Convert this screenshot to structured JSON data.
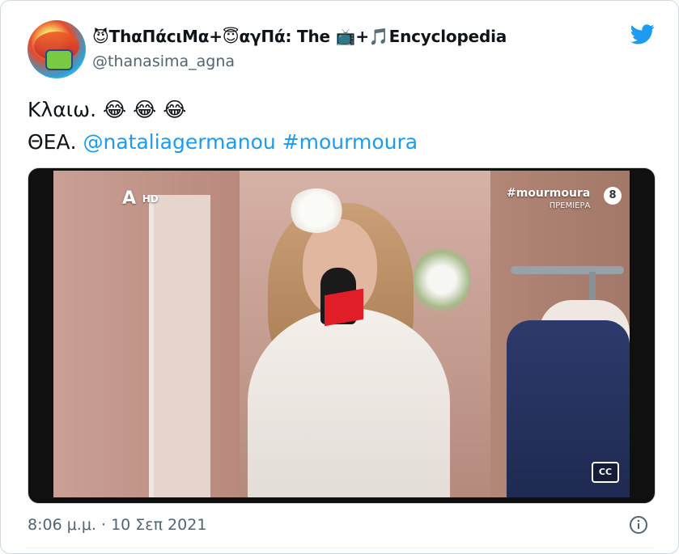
{
  "tweet": {
    "display_name": "😈ThαΠάcιΜα+😇αγΠά: The 📺+🎵Encyclopedia",
    "username": "@thanasima_agna",
    "text_line1": "Κλαιω. 😂 😂 😂",
    "text_line2_prefix": "ΘΕΑ. ",
    "mention": "@nataliagermanou",
    "hashtag": "#mourmoura",
    "timestamp": "8:06 μ.μ. · 10 Σεπ 2021"
  },
  "video_overlay": {
    "channel_logo": "Α",
    "channel_hd": "HD",
    "hashtag": "#mourmoura",
    "premiere_label": "ΠΡΕΜΙΕΡΑ",
    "rating": "8",
    "cc_label": "CC"
  },
  "colors": {
    "link": "#1d9bf0",
    "secondary_text": "#536471",
    "twitter_blue": "#1d9bf0"
  },
  "icons": {
    "brand": "twitter-bird-icon",
    "info": "info-icon"
  }
}
